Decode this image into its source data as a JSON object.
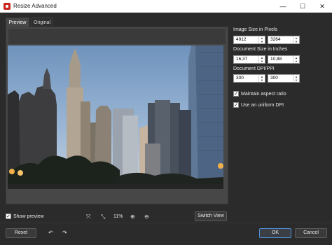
{
  "window": {
    "title": "Resize Advanced",
    "minimize": "—",
    "maximize": "☐",
    "close": "✕"
  },
  "tabs": [
    {
      "label": "Preview",
      "active": true
    },
    {
      "label": "Original",
      "active": false
    }
  ],
  "settings": {
    "pixels_label": "Image Size in Pixels",
    "pixel_width": "4912",
    "pixel_height": "3264",
    "inches_label": "Document Size in Inches",
    "inch_width": "16,37",
    "inch_height": "10,88",
    "dpi_label": "Document DPI/PPI",
    "dpi_x": "300",
    "dpi_y": "300",
    "maintain_aspect": {
      "label": "Maintain aspect ratio",
      "checked": true
    },
    "uniform_dpi": {
      "label": "Use an uniform DPI",
      "checked": true
    }
  },
  "preview_bar": {
    "show_preview": {
      "label": "Show preview",
      "checked": true
    },
    "fit_icon": "fit-icon",
    "actual_size_icon": "actual-size-icon",
    "zoom_level": "11%",
    "zoom_in_icon": "zoom-in-icon",
    "zoom_out_icon": "zoom-out-icon",
    "switch_view_label": "Switch View"
  },
  "footer": {
    "reset_label": "Reset",
    "undo_icon": "undo-icon",
    "redo_icon": "redo-icon",
    "ok_label": "OK",
    "cancel_label": "Cancel"
  },
  "colors": {
    "dialog_bg": "#2b2b2b",
    "accent": "#4f8fd6",
    "titlebar_icon": "#c9261f"
  }
}
